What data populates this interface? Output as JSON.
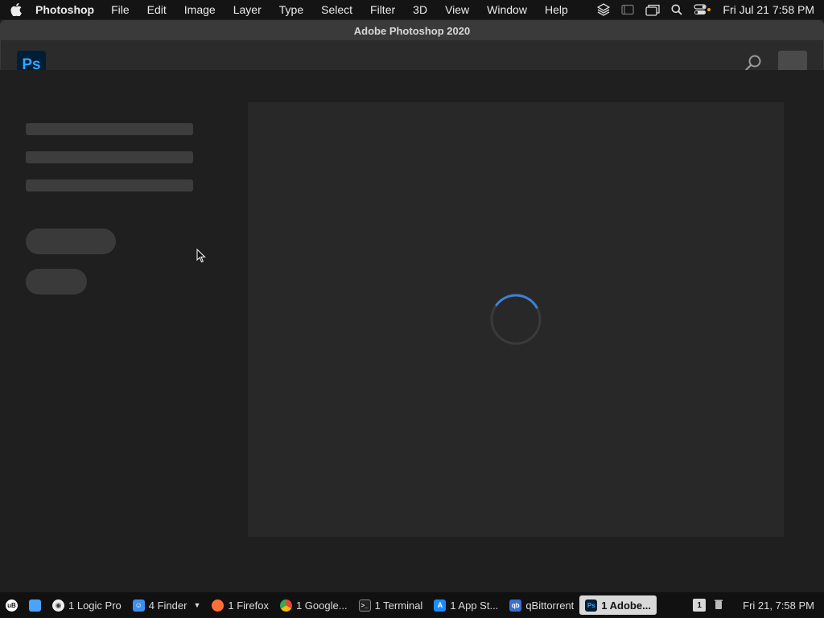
{
  "menubar": {
    "app_name": "Photoshop",
    "menus": [
      "File",
      "Edit",
      "Image",
      "Layer",
      "Type",
      "Select",
      "Filter",
      "3D",
      "View",
      "Window",
      "Help"
    ],
    "clock": "Fri Jul 21  7:58 PM",
    "status_icons": [
      "layers-icon",
      "screen-icon",
      "windows-icon",
      "search-icon",
      "control-center-icon"
    ]
  },
  "window": {
    "title": "Adobe Photoshop 2020",
    "logo_text": "Ps"
  },
  "colors": {
    "ps_blue": "#31a8ff",
    "ps_dark": "#001e36",
    "spinner": "#3b82d6"
  },
  "taskbar": {
    "items": [
      {
        "label": "1 Logic Pro",
        "icon": "logic-pro-icon"
      },
      {
        "label": "4 Finder",
        "icon": "finder-icon"
      },
      {
        "label": "1 Firefox",
        "icon": "firefox-icon"
      },
      {
        "label": "1 Google...",
        "icon": "chrome-icon"
      },
      {
        "label": "1 Terminal",
        "icon": "terminal-icon"
      },
      {
        "label": "1 App St...",
        "icon": "app-store-icon"
      },
      {
        "label": "qBittorrent",
        "icon": "qbittorrent-icon"
      },
      {
        "label": "1 Adobe...",
        "icon": "photoshop-icon",
        "active": true
      }
    ],
    "badge": "1",
    "clock": "Fri 21, 7:58 PM"
  }
}
